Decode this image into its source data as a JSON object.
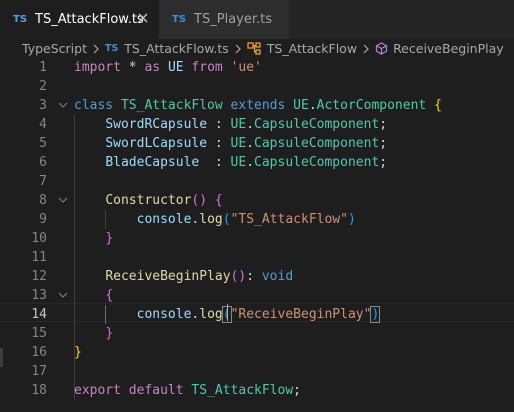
{
  "tabs": [
    {
      "badge": "TS",
      "label": "TS_AttackFlow.ts",
      "active": true
    },
    {
      "badge": "TS",
      "label": "TS_Player.ts",
      "active": false
    }
  ],
  "breadcrumb": {
    "items": [
      "TypeScript",
      "TS_AttackFlow.ts",
      "TS_AttackFlow",
      "ReceiveBeginPlay"
    ],
    "file_badge": "TS"
  },
  "editor": {
    "active_line": 14,
    "line_numbers": [
      "1",
      "2",
      "3",
      "4",
      "5",
      "6",
      "7",
      "8",
      "9",
      "10",
      "11",
      "12",
      "13",
      "14",
      "15",
      "16",
      "17",
      "18"
    ],
    "lines": [
      [
        [
          "kw",
          "import"
        ],
        [
          "pu",
          " * "
        ],
        [
          "kw",
          "as"
        ],
        [
          "pu",
          " "
        ],
        [
          "va",
          "UE"
        ],
        [
          "pu",
          " "
        ],
        [
          "kw",
          "from"
        ],
        [
          "pu",
          " "
        ],
        [
          "st",
          "'ue'"
        ]
      ],
      [],
      [
        [
          "kb",
          "class"
        ],
        [
          "pu",
          " "
        ],
        [
          "ty",
          "TS_AttackFlow"
        ],
        [
          "pu",
          " "
        ],
        [
          "kb",
          "extends"
        ],
        [
          "pu",
          " "
        ],
        [
          "ty",
          "UE"
        ],
        [
          "pu",
          "."
        ],
        [
          "ty",
          "ActorComponent"
        ],
        [
          "pu",
          " "
        ],
        [
          "br1",
          "{"
        ]
      ],
      [
        [
          "pu",
          "    "
        ],
        [
          "va",
          "SwordRCapsule"
        ],
        [
          "pu",
          " : "
        ],
        [
          "ty",
          "UE"
        ],
        [
          "pu",
          "."
        ],
        [
          "ty",
          "CapsuleComponent"
        ],
        [
          "pu",
          ";"
        ]
      ],
      [
        [
          "pu",
          "    "
        ],
        [
          "va",
          "SwordLCapsule"
        ],
        [
          "pu",
          " : "
        ],
        [
          "ty",
          "UE"
        ],
        [
          "pu",
          "."
        ],
        [
          "ty",
          "CapsuleComponent"
        ],
        [
          "pu",
          ";"
        ]
      ],
      [
        [
          "pu",
          "    "
        ],
        [
          "va",
          "BladeCapsule"
        ],
        [
          "pu",
          "  : "
        ],
        [
          "ty",
          "UE"
        ],
        [
          "pu",
          "."
        ],
        [
          "ty",
          "CapsuleComponent"
        ],
        [
          "pu",
          ";"
        ]
      ],
      [],
      [
        [
          "pu",
          "    "
        ],
        [
          "fn",
          "Constructor"
        ],
        [
          "br2",
          "()"
        ],
        [
          "pu",
          " "
        ],
        [
          "br2",
          "{"
        ]
      ],
      [
        [
          "pu",
          "        "
        ],
        [
          "va",
          "console"
        ],
        [
          "pu",
          "."
        ],
        [
          "fn",
          "log"
        ],
        [
          "br3",
          "("
        ],
        [
          "st",
          "\"TS_AttackFlow\""
        ],
        [
          "br3",
          ")"
        ]
      ],
      [
        [
          "pu",
          "    "
        ],
        [
          "br2",
          "}"
        ]
      ],
      [],
      [
        [
          "pu",
          "    "
        ],
        [
          "fn",
          "ReceiveBeginPlay"
        ],
        [
          "br2",
          "()"
        ],
        [
          "pu",
          ": "
        ],
        [
          "kb",
          "void"
        ]
      ],
      [
        [
          "pu",
          "    "
        ],
        [
          "br2",
          "{"
        ]
      ],
      [
        [
          "pu",
          "        "
        ],
        [
          "va",
          "console"
        ],
        [
          "pu",
          "."
        ],
        [
          "fn",
          "log"
        ],
        [
          "br3 bm",
          "("
        ],
        [
          "st",
          "\"ReceiveBeginPlay\""
        ],
        [
          "br3 bm",
          ")"
        ]
      ],
      [
        [
          "pu",
          "    "
        ],
        [
          "br2",
          "}"
        ]
      ],
      [
        [
          "br1",
          "}"
        ]
      ],
      [],
      [
        [
          "kw",
          "export"
        ],
        [
          "pu",
          " "
        ],
        [
          "kw",
          "default"
        ],
        [
          "pu",
          " "
        ],
        [
          "ty",
          "TS_AttackFlow"
        ],
        [
          "pu",
          ";"
        ]
      ]
    ],
    "folds": [
      3,
      8,
      13
    ]
  },
  "colors": {
    "background": "#1e1e1e",
    "tab_bar": "#252526",
    "ts_badge": "#3a8fd6",
    "keyword": "#c586c0",
    "storage": "#569cd6",
    "type": "#4ec9b0",
    "variable": "#9cdcfe",
    "function": "#dcdcaa",
    "string": "#ce9178"
  },
  "icons": {
    "close": "close-icon",
    "chevron": "chevron-right-icon",
    "class": "class-icon",
    "method": "method-icon",
    "fold": "fold-chevron-icon"
  }
}
